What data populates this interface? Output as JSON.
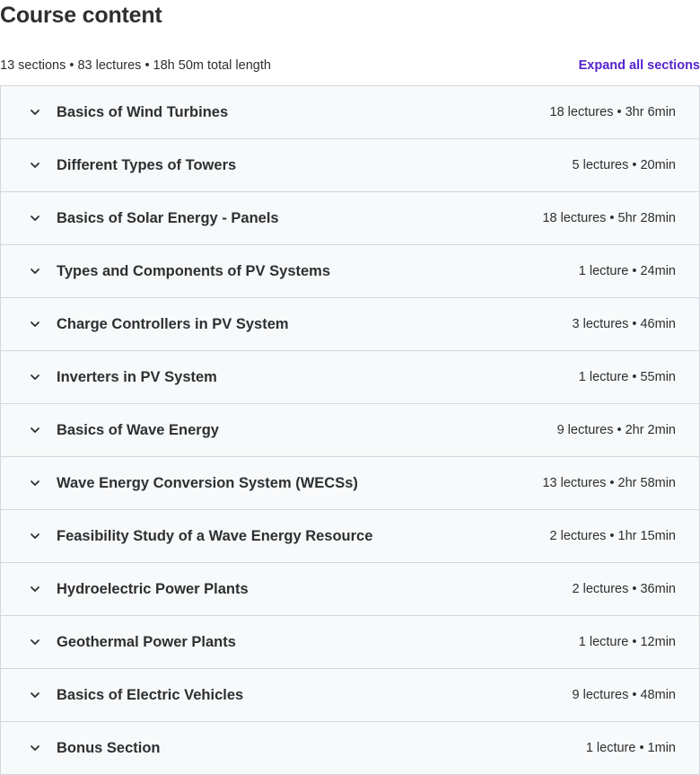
{
  "header": {
    "title": "Course content",
    "summary": "13 sections • 83 lectures • 18h 50m total length",
    "expand_label": "Expand all sections"
  },
  "colors": {
    "link": "#5624d0",
    "row_bg": "#f7f9fa",
    "border": "#d1d7dc",
    "text": "#2d2f31"
  },
  "icons": {
    "section_toggle": "chevron-down-icon"
  },
  "sections": [
    {
      "title": "Basics of Wind Turbines",
      "info": "18 lectures • 3hr 6min"
    },
    {
      "title": "Different Types of Towers",
      "info": "5 lectures • 20min"
    },
    {
      "title": "Basics of Solar Energy - Panels",
      "info": "18 lectures • 5hr 28min"
    },
    {
      "title": "Types and Components of PV Systems",
      "info": "1 lecture • 24min"
    },
    {
      "title": "Charge Controllers in PV System",
      "info": "3 lectures • 46min"
    },
    {
      "title": "Inverters in PV System",
      "info": "1 lecture • 55min"
    },
    {
      "title": "Basics of Wave Energy",
      "info": "9 lectures • 2hr 2min"
    },
    {
      "title": "Wave Energy Conversion System (WECSs)",
      "info": "13 lectures • 2hr 58min"
    },
    {
      "title": "Feasibility Study of a Wave Energy Resource",
      "info": "2 lectures • 1hr 15min"
    },
    {
      "title": "Hydroelectric Power Plants",
      "info": "2 lectures • 36min"
    },
    {
      "title": "Geothermal Power Plants",
      "info": "1 lecture • 12min"
    },
    {
      "title": "Basics of Electric Vehicles",
      "info": "9 lectures • 48min"
    },
    {
      "title": "Bonus Section",
      "info": "1 lecture • 1min"
    }
  ]
}
